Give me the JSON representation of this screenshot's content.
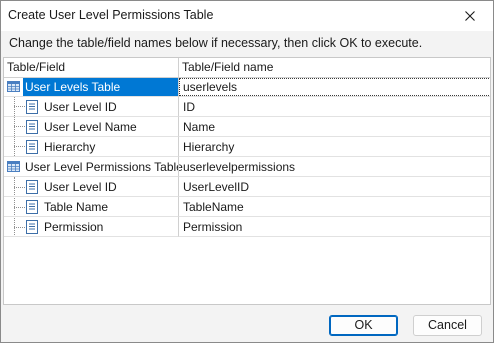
{
  "window": {
    "title": "Create User Level Permissions Table",
    "close_icon": "close-icon"
  },
  "instruction": "Change the table/field names below if necessary, then click OK to execute.",
  "grid": {
    "columns": [
      "Table/Field",
      "Table/Field name"
    ],
    "rows": [
      {
        "type": "table",
        "label": "User Levels Table",
        "value": "userlevels",
        "selected": true,
        "icon": "table-icon"
      },
      {
        "type": "field",
        "label": "User Level ID",
        "value": "ID",
        "icon": "field-icon"
      },
      {
        "type": "field",
        "label": "User Level Name",
        "value": "Name",
        "icon": "field-icon"
      },
      {
        "type": "field",
        "label": "Hierarchy",
        "value": "Hierarchy",
        "icon": "field-icon"
      },
      {
        "type": "table",
        "label": "User Level Permissions Table",
        "value": "userlevelpermissions",
        "icon": "table-icon"
      },
      {
        "type": "field",
        "label": "User Level ID",
        "value": "UserLevelID",
        "icon": "field-icon"
      },
      {
        "type": "field",
        "label": "Table Name",
        "value": "TableName",
        "icon": "field-icon"
      },
      {
        "type": "field",
        "label": "Permission",
        "value": "Permission",
        "icon": "field-icon"
      }
    ]
  },
  "buttons": {
    "ok": "OK",
    "cancel": "Cancel"
  },
  "colors": {
    "selection": "#0078d4",
    "default_button_border": "#0067c0",
    "table_icon": "#4a7fc1"
  }
}
